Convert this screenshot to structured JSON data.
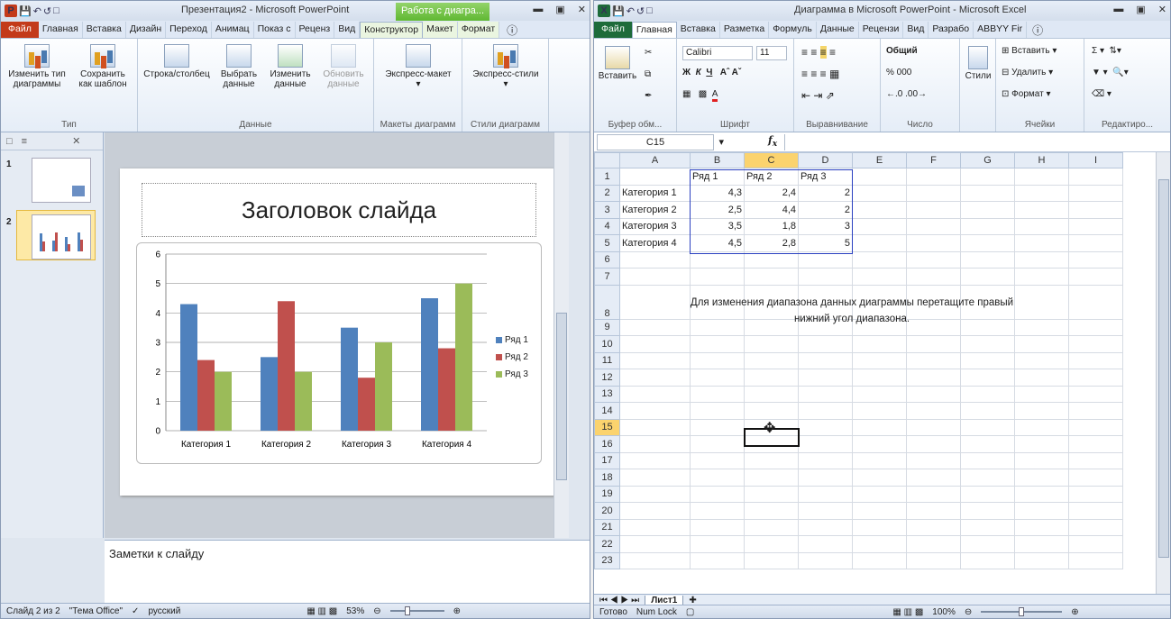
{
  "ppt": {
    "title": "Презентация2 - Microsoft PowerPoint",
    "context_tab": "Работа с диагра...",
    "tabs": [
      "Файл",
      "Главная",
      "Вставка",
      "Дизайн",
      "Переход",
      "Анимац",
      "Показ с",
      "Реценз",
      "Вид",
      "Конструктор",
      "Макет",
      "Формат"
    ],
    "ribbon": {
      "type_group": "Тип",
      "change_type": "Изменить тип",
      "change_type2": "диаграммы",
      "save_template": "Сохранить",
      "save_template2": "как шаблон",
      "data_group": "Данные",
      "switch_rowcol": "Строка/столбец",
      "select_data": "Выбрать",
      "select_data2": "данные",
      "edit_data": "Изменить",
      "edit_data2": "данные",
      "refresh_data": "Обновить",
      "refresh_data2": "данные",
      "layouts_group": "Макеты диаграмм",
      "quick_layout": "Экспресс-макет",
      "styles_group": "Стили диаграмм",
      "quick_styles": "Экспресс-стили"
    },
    "thumbs": {
      "n1": "1",
      "n2": "2"
    },
    "slide": {
      "title": "Заголовок слайда"
    },
    "notes": "Заметки к слайду",
    "status": {
      "slide": "Слайд 2 из 2",
      "theme": "\"Тема Office\"",
      "lang": "русский",
      "zoom": "53%"
    }
  },
  "chart_data": {
    "type": "bar",
    "categories": [
      "Категория 1",
      "Категория 2",
      "Категория 3",
      "Категория 4"
    ],
    "series": [
      {
        "name": "Ряд 1",
        "values": [
          4.3,
          2.5,
          3.5,
          4.5
        ],
        "color": "#4f81bd"
      },
      {
        "name": "Ряд 2",
        "values": [
          2.4,
          4.4,
          1.8,
          2.8
        ],
        "color": "#c0504d"
      },
      {
        "name": "Ряд 3",
        "values": [
          2,
          2,
          3,
          5
        ],
        "color": "#9bbb59"
      }
    ],
    "ylim": [
      0,
      6
    ],
    "yticks": [
      "0",
      "1",
      "2",
      "3",
      "4",
      "5",
      "6"
    ],
    "grid": true,
    "legend": "right"
  },
  "excel": {
    "title": "Диаграмма в Microsoft PowerPoint - Microsoft Excel",
    "tabs": [
      "Файл",
      "Главная",
      "Вставка",
      "Разметка",
      "Формуль",
      "Данные",
      "Рецензи",
      "Вид",
      "Разрабо",
      "ABBYY Fir"
    ],
    "ribbon": {
      "clipboard": "Буфер обм...",
      "paste": "Вставить",
      "font_group": "Шрифт",
      "font": "Calibri",
      "font_size": "11",
      "align_group": "Выравнивание",
      "number_group": "Число",
      "number_format": "Общий",
      "percent": "% 000",
      "styles": "Стили",
      "cells_group": "Ячейки",
      "insert": "Вставить",
      "delete": "Удалить",
      "format": "Формат",
      "edit_group": "Редактиро..."
    },
    "namebox": "C15",
    "col_headers": [
      "A",
      "B",
      "C",
      "D",
      "E",
      "F",
      "G",
      "H",
      "I"
    ],
    "rows": [
      [
        "",
        "Ряд 1",
        "Ряд 2",
        "Ряд 3",
        "",
        "",
        "",
        "",
        ""
      ],
      [
        "Категория 1",
        "4,3",
        "2,4",
        "2",
        "",
        "",
        "",
        "",
        ""
      ],
      [
        "Категория 2",
        "2,5",
        "4,4",
        "2",
        "",
        "",
        "",
        "",
        ""
      ],
      [
        "Категория 3",
        "3,5",
        "1,8",
        "3",
        "",
        "",
        "",
        "",
        ""
      ],
      [
        "Категория 4",
        "4,5",
        "2,8",
        "5",
        "",
        "",
        "",
        "",
        ""
      ]
    ],
    "note": "Для изменения диапазона данных диаграммы перетащите правый нижний угол диапазона.",
    "sheet": "Лист1",
    "status": {
      "ready": "Готово",
      "numlock": "Num Lock",
      "zoom": "100%"
    }
  }
}
